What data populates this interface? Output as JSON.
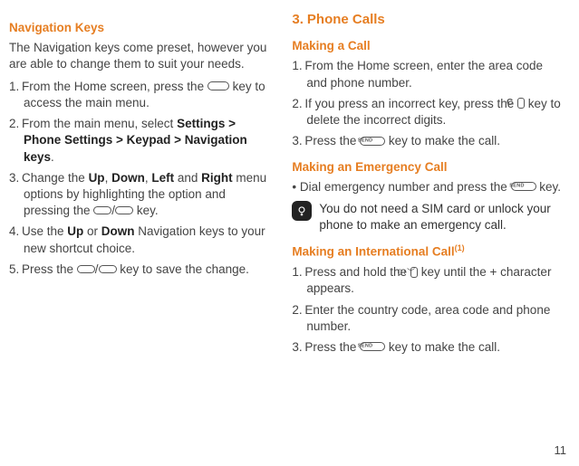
{
  "page_number": "11",
  "left": {
    "h3_nav": "Navigation Keys",
    "intro": "The Navigation keys come preset, however you are able to change them to suit your needs.",
    "steps": [
      {
        "n": "1.",
        "before": "From the Home screen, press the ",
        "after": " key to access the main menu."
      },
      {
        "n": "2.",
        "plain_a": "From the main menu, select ",
        "bold": "Settings > Phone Settings > Keypad > Navigation keys",
        "plain_b": "."
      },
      {
        "n": "3.",
        "a": "Change the ",
        "b1": "Up",
        "c1": ", ",
        "b2": "Down",
        "c2": ", ",
        "b3": "Left",
        "c3": " and ",
        "b4": "Right",
        "d": " menu options by highlighting the option and pressing the ",
        "e": " key."
      },
      {
        "n": "4.",
        "a": "Use the ",
        "b1": "Up",
        "c1": " or ",
        "b2": "Down",
        "d": " Navigation keys to your new shortcut choice."
      },
      {
        "n": "5.",
        "a": "Press the ",
        "b": " key to save the change."
      }
    ]
  },
  "right": {
    "h2_num": "3.",
    "h2_title": "Phone Calls",
    "h3_making": "Making a Call",
    "making_steps": [
      {
        "n": "1.",
        "text": "From the Home screen, enter the area code and phone number."
      },
      {
        "n": "2.",
        "a": "If you press an incorrect key, press the ",
        "b": " key to delete the incorrect digits."
      },
      {
        "n": "3.",
        "a": "Press the ",
        "b": " key to make the call."
      }
    ],
    "h3_emergency": "Making an Emergency Call",
    "emergency_bullet_a": "Dial emergency number and press the ",
    "emergency_bullet_b": " key.",
    "note_text": "You do not need a SIM card or unlock your phone to make an emergency call.",
    "h3_intl": "Making an International Call",
    "intl_sup": "(1)",
    "intl_steps": [
      {
        "n": "1.",
        "a": "Press and hold the ",
        "b": " key until the + character appears."
      },
      {
        "n": "2.",
        "text": "Enter the country code, area code and phone number."
      },
      {
        "n": "3.",
        "a": "Press the ",
        "b": " key to make the call."
      }
    ]
  },
  "icons": {
    "send_label": "SEND",
    "c_label": "C",
    "plus_label": "0+﹀"
  }
}
